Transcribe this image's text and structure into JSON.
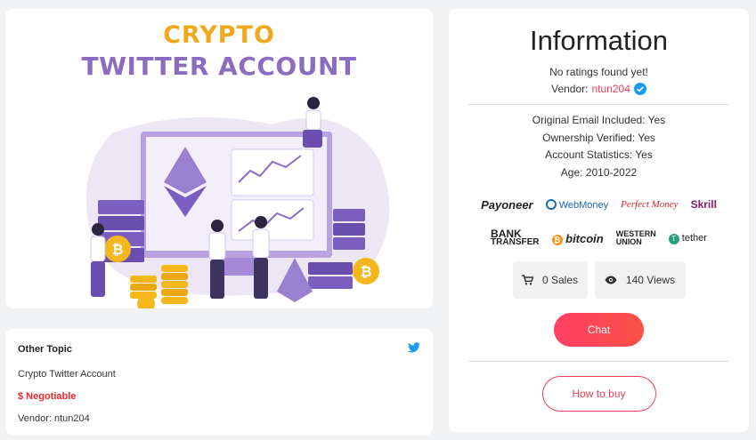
{
  "banner": {
    "title_line1": "CRYPTO",
    "title_line2": "TWITTER ACCOUNT"
  },
  "topic": {
    "category": "Other Topic",
    "title": "Crypto Twitter Account",
    "price": "$ Negotiable",
    "vendor": "Vendor: ntun204",
    "icon": "twitter-icon"
  },
  "info": {
    "heading": "Information",
    "ratings": "No ratings found yet!",
    "vendor_label": "Vendor:",
    "vendor_name": "ntun204",
    "attributes": [
      "Original Email Included: Yes",
      "Ownership Verified: Yes",
      "Account Statistics: Yes",
      "Age: 2010-2022"
    ],
    "payments_row1": [
      "Payoneer",
      "WebMoney",
      "Perfect Money",
      "Skrill"
    ],
    "payments_row2": [
      "BANK",
      "TRANSFER",
      "bitcoin",
      "WESTERN",
      "UNION",
      "tether"
    ],
    "sales": "0 Sales",
    "views": "140 Views",
    "chat_label": "Chat",
    "howto_label": "How to buy"
  },
  "colors": {
    "accent": "#ef3f56",
    "verified": "#1d9bf0",
    "twitter": "#1d9bf0",
    "banner_gold": "#f0a81c",
    "banner_purple": "#8a6cc0"
  }
}
